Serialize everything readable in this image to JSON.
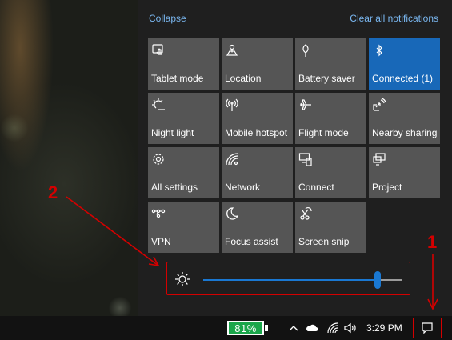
{
  "header": {
    "collapse_label": "Collapse",
    "clear_label": "Clear all notifications"
  },
  "tiles": [
    {
      "label": "Tablet mode",
      "icon": "tablet-mode-icon",
      "active": false
    },
    {
      "label": "Location",
      "icon": "location-icon",
      "active": false
    },
    {
      "label": "Battery saver",
      "icon": "battery-saver-icon",
      "active": false
    },
    {
      "label": "Connected (1)",
      "icon": "bluetooth-icon",
      "active": true
    },
    {
      "label": "Night light",
      "icon": "night-light-icon",
      "active": false
    },
    {
      "label": "Mobile hotspot",
      "icon": "mobile-hotspot-icon",
      "active": false
    },
    {
      "label": "Flight mode",
      "icon": "airplane-icon",
      "active": false
    },
    {
      "label": "Nearby sharing",
      "icon": "nearby-sharing-icon",
      "active": false
    },
    {
      "label": "All settings",
      "icon": "gear-icon",
      "active": false
    },
    {
      "label": "Network",
      "icon": "network-icon",
      "active": false
    },
    {
      "label": "Connect",
      "icon": "connect-icon",
      "active": false
    },
    {
      "label": "Project",
      "icon": "project-icon",
      "active": false
    },
    {
      "label": "VPN",
      "icon": "vpn-icon",
      "active": false
    },
    {
      "label": "Focus assist",
      "icon": "moon-icon",
      "active": false
    },
    {
      "label": "Screen snip",
      "icon": "screen-snip-icon",
      "active": false
    }
  ],
  "brightness": {
    "icon": "brightness-sun-icon",
    "level": 0.88
  },
  "annotations": {
    "label_1": "1",
    "label_2": "2",
    "color": "#d40000"
  },
  "taskbar": {
    "battery_percent": "81%",
    "battery_color": "#1aa64a",
    "time": "3:29 PM",
    "tray_icons": [
      "chevron-up-icon",
      "onedrive-cloud-icon",
      "wifi-icon",
      "volume-icon"
    ],
    "action_center_icon": "action-center-icon"
  },
  "colors": {
    "panel_bg": "#1f1f1f",
    "tile_bg": "#555555",
    "tile_active_bg": "#1868b8",
    "link": "#7ab7f0",
    "slider_accent": "#1a78d2"
  }
}
